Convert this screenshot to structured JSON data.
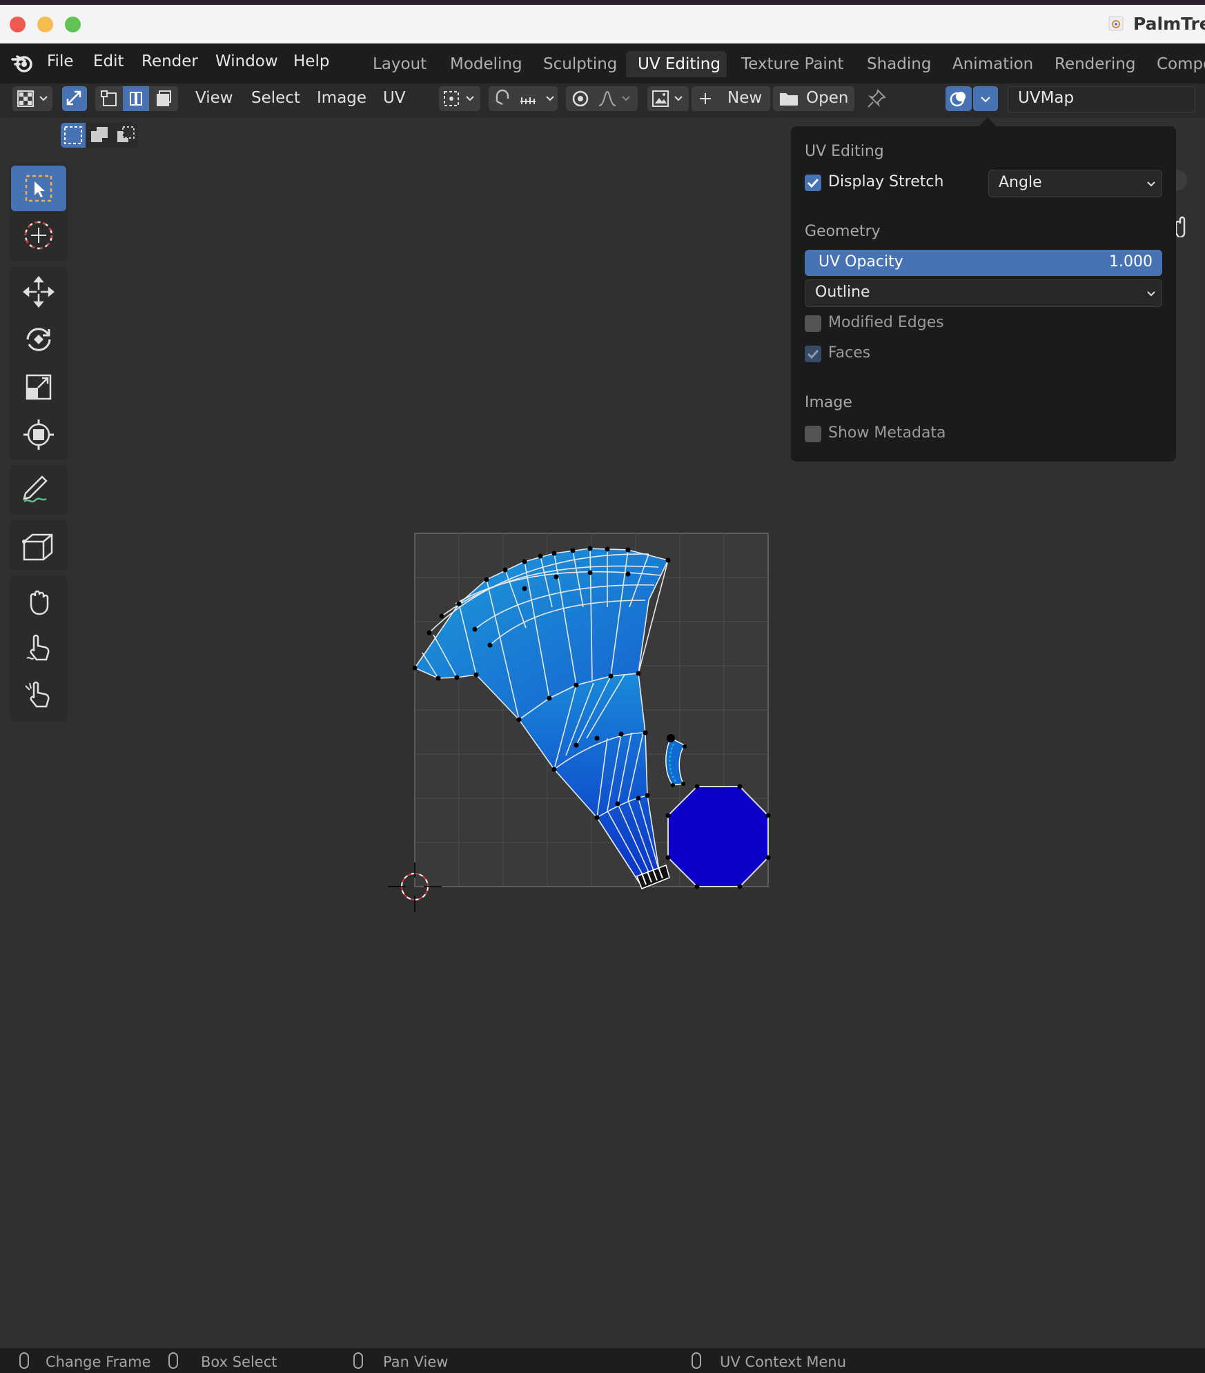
{
  "window": {
    "title": "PalmTre",
    "traffic_colors": {
      "close": "#ee5a52",
      "minimize": "#f5bd4f",
      "zoom": "#5fc453"
    }
  },
  "menubar": {
    "items": [
      "File",
      "Edit",
      "Render",
      "Window",
      "Help"
    ],
    "workspace_tabs": [
      "Layout",
      "Modeling",
      "Sculpting",
      "UV Editing",
      "Texture Paint",
      "Shading",
      "Animation",
      "Rendering",
      "Compo"
    ],
    "active_tab": "UV Editing"
  },
  "header": {
    "menus": [
      "View",
      "Select",
      "Image",
      "UV"
    ],
    "new_label": "New",
    "open_label": "Open",
    "uvmap_value": "UVMap"
  },
  "overlay_popover": {
    "section_uv_editing": "UV Editing",
    "display_stretch_label": "Display Stretch",
    "display_stretch_checked": true,
    "stretch_mode": "Angle",
    "section_geometry": "Geometry",
    "uv_opacity_label": "UV Opacity",
    "uv_opacity_value": "1.000",
    "edge_display": "Outline",
    "modified_edges_label": "Modified Edges",
    "modified_edges_checked": false,
    "faces_label": "Faces",
    "faces_checked": true,
    "section_image": "Image",
    "show_metadata_label": "Show Metadata",
    "show_metadata_checked": false
  },
  "toolbar": {
    "tools": [
      "select-box-icon",
      "cursor-icon",
      "move-icon",
      "rotate-icon",
      "scale-icon",
      "transform-icon",
      "annotate-icon",
      "rip-region-icon",
      "grab-icon",
      "relax-icon",
      "pinch-icon"
    ]
  },
  "statusbar": {
    "items": [
      "Change Frame",
      "Box Select",
      "Pan View",
      "UV Context Menu"
    ]
  },
  "colors": {
    "accent": "#4772b3",
    "uv_fill_deep": "#0a00c8",
    "uv_fill_light": "#1aa0e0"
  }
}
